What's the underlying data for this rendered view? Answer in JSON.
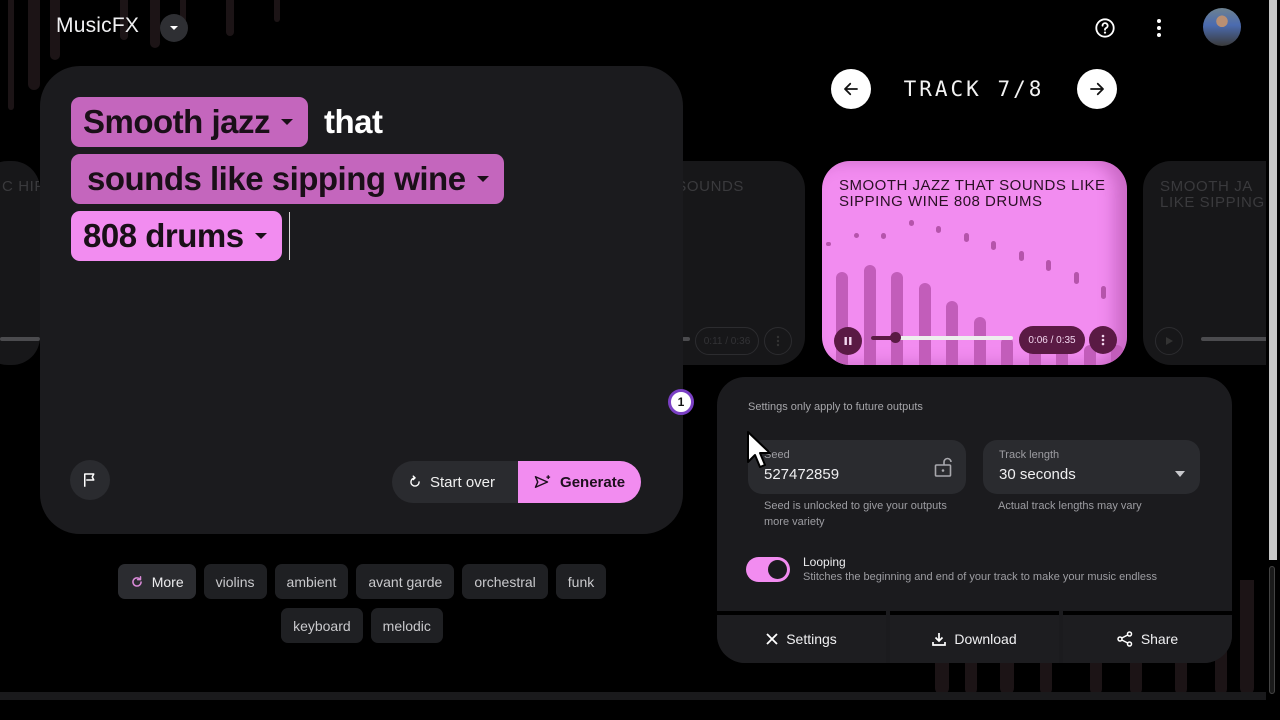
{
  "app": {
    "title": "MusicFX",
    "title_dropdown_icon": "chevron-down-icon"
  },
  "header": {
    "help_icon": "help-circle-icon",
    "menu_icon": "more-vert-icon",
    "avatar": "user-avatar"
  },
  "track_nav": {
    "label": "TRACK 7/8",
    "current": 7,
    "total": 8,
    "prev_icon": "arrow-left-icon",
    "next_icon": "arrow-right-icon"
  },
  "prompt": {
    "chips": [
      {
        "text": "Smooth jazz",
        "style": "dark"
      },
      {
        "text": "sounds like sipping wine",
        "style": "dark"
      },
      {
        "text": "808 drums",
        "style": "light"
      }
    ],
    "connector_word": "that",
    "flag_icon": "flag-icon",
    "start_over_label": "Start over",
    "generate_label": "Generate"
  },
  "suggestions": {
    "more_label": "More",
    "items": [
      "violins",
      "ambient",
      "avant garde",
      "orchestral",
      "funk",
      "keyboard",
      "melodic"
    ]
  },
  "cards": {
    "prev_far": {
      "title": "C HIP"
    },
    "prev": {
      "title": "T SOUNDS",
      "time": "0:11 / 0:36"
    },
    "active": {
      "title": "Smooth jazz that sounds like sipping wine 808 drums",
      "time": "0:06 / 0:35",
      "elapsed_seconds": 6,
      "duration_seconds": 35,
      "progress_fraction": 0.17,
      "state": "playing",
      "waveform_levels": [
        0.62,
        0.67,
        0.62,
        0.55,
        0.43,
        0.32,
        0.19,
        0.08,
        0.05,
        0.01,
        0.12
      ],
      "waveform_peaks": [
        0.82,
        0.88,
        0.88,
        0.97,
        0.93,
        0.88,
        0.83,
        0.76,
        0.7,
        0.62,
        0.53
      ]
    },
    "next": {
      "title": "Smooth ja like sipping"
    }
  },
  "settings": {
    "note": "Settings only apply to future outputs",
    "seed": {
      "label": "Seed",
      "value": "527472859",
      "help": "Seed is unlocked to give your outputs more variety",
      "lock_icon": "unlock-icon"
    },
    "track_length": {
      "label": "Track length",
      "value": "30 seconds",
      "help": "Actual track lengths may vary"
    },
    "looping": {
      "label": "Looping",
      "description": "Stitches the beginning and end of your track to make your music endless",
      "enabled": true
    },
    "buttons": {
      "settings_label": "Settings",
      "download_label": "Download",
      "share_label": "Share"
    }
  },
  "annotation": {
    "step_number": "1"
  },
  "colors": {
    "accent_pink": "#f28cf0",
    "chip_purple": "#c466bd",
    "dark_plum": "#5a1a44",
    "panel": "#1b1b1e"
  }
}
